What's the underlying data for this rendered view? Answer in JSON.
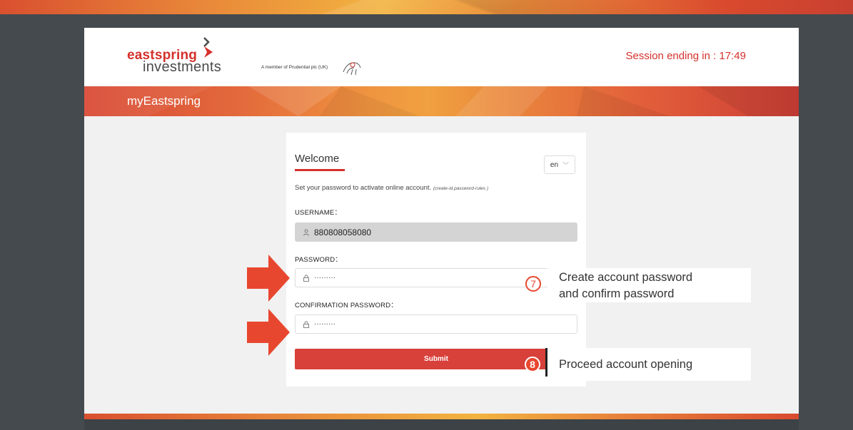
{
  "header": {
    "logo_line1": "eastspring",
    "logo_line2": "investments",
    "member_text": "A member of Prudential plc (UK)",
    "session_text": "Session ending in : 17:49"
  },
  "banner": {
    "brand": "myEastspring"
  },
  "form": {
    "title": "Welcome",
    "language": "en",
    "intro": "Set your password to activate online account.",
    "intro_hint": "(create-id.password-rules )",
    "username_label": "USERNAME：",
    "username_value": "880808058080",
    "password_label": "PASSWORD：",
    "password_value": "·········",
    "confirm_label": "CONFIRMATION PASSWORD：",
    "confirm_value": "·········",
    "submit_label": "Submit"
  },
  "annotations": {
    "step7_number": "7",
    "step7_line1": "Create account password",
    "step7_line2": "and confirm password",
    "step8_number": "8",
    "step8_text": "Proceed account opening"
  },
  "colors": {
    "brand_red": "#d4312c",
    "arrow_red": "#e8472f",
    "background_dark": "#454a4f"
  },
  "icons": [
    "user-icon",
    "lock-icon",
    "chevron-down-icon",
    "arrow-right-icon",
    "chevron-right-icon"
  ]
}
